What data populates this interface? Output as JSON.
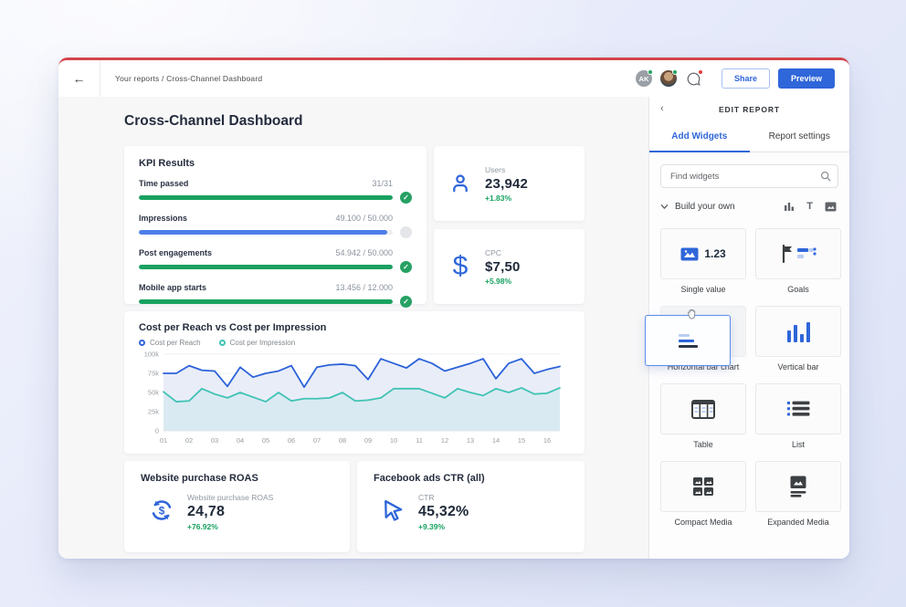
{
  "colors": {
    "accent_red": "#d4444c",
    "primary_blue": "#2f66d9",
    "green": "#17a261",
    "teal": "#3fc3b4"
  },
  "topbar": {
    "breadcrumb": "Your reports / Cross-Channel Dashboard",
    "avatar_initials": "AK",
    "share_label": "Share",
    "preview_label": "Preview"
  },
  "page": {
    "title": "Cross-Channel Dashboard"
  },
  "kpi": {
    "title": "KPI Results",
    "rows": [
      {
        "label": "Time passed",
        "value": "31/31",
        "pct": 100,
        "color": "green",
        "done": true
      },
      {
        "label": "Impressions",
        "value": "49.100 / 50.000",
        "pct": 98,
        "color": "blue",
        "done": false
      },
      {
        "label": "Post engagements",
        "value": "54.942 / 50.000",
        "pct": 100,
        "color": "green",
        "done": true
      },
      {
        "label": "Mobile app starts",
        "value": "13.456 / 12.000",
        "pct": 100,
        "color": "green",
        "done": true
      }
    ]
  },
  "stats": [
    {
      "label": "Users",
      "value": "23,942",
      "change": "+1.83%",
      "icon": "user-icon"
    },
    {
      "label": "CPC",
      "value": "$7,50",
      "change": "+5.98%",
      "icon": "dollar-icon"
    }
  ],
  "chart_data": {
    "type": "line",
    "title": "Cost per Reach vs Cost per Impression",
    "unit": "thousands",
    "ylim": [
      0,
      100
    ],
    "y_ticks": [
      "0",
      "25k",
      "50k",
      "75k",
      "100k"
    ],
    "x_labels": [
      "01",
      "02",
      "03",
      "04",
      "05",
      "06",
      "07",
      "08",
      "09",
      "10",
      "11",
      "12",
      "13",
      "14",
      "15",
      "16"
    ],
    "grid": true,
    "legend_position": "top",
    "series": [
      {
        "name": "Cost per Reach",
        "color": "#2c62d9",
        "fill": "#e9edf8",
        "values": [
          75,
          75,
          85,
          79,
          78,
          58,
          83,
          70,
          75,
          78,
          85,
          57,
          83,
          86,
          87,
          85,
          67,
          94,
          88,
          82,
          94,
          88,
          78,
          83,
          88,
          94,
          68,
          88,
          94,
          75,
          80,
          84
        ]
      },
      {
        "name": "Cost per Impression",
        "color": "#3fc3b4",
        "fill": "#daeaf2",
        "values": [
          51,
          38,
          39,
          55,
          48,
          43,
          50,
          44,
          38,
          50,
          39,
          42,
          42,
          43,
          50,
          39,
          40,
          43,
          55,
          55,
          55,
          49,
          43,
          55,
          50,
          46,
          55,
          50,
          56,
          48,
          49,
          56
        ]
      }
    ]
  },
  "bottom_cards": [
    {
      "title": "Website purchase ROAS",
      "label": "Website purchase ROAS",
      "value": "24,78",
      "change": "+76.92%",
      "icon": "roas-cycle-icon"
    },
    {
      "title": "Facebook ads CTR (all)",
      "label": "CTR",
      "value": "45,32%",
      "change": "+9.39%",
      "icon": "cursor-icon"
    }
  ],
  "sidebar": {
    "header": "EDIT REPORT",
    "tabs": [
      {
        "label": "Add Widgets",
        "active": true
      },
      {
        "label": "Report settings",
        "active": false
      }
    ],
    "search_placeholder": "Find widgets",
    "section": {
      "label": "Build your own",
      "tools": [
        "bar-chart-icon",
        "text-icon",
        "image-icon"
      ]
    },
    "widgets": [
      {
        "label": "Single value",
        "icon": "single-value-icon",
        "sample": "1.23"
      },
      {
        "label": "Goals",
        "icon": "goals-icon"
      },
      {
        "label": "Horizontal bar chart",
        "icon": "horizontal-bar-icon",
        "state": "dragging"
      },
      {
        "label": "Vertical bar",
        "icon": "vertical-bar-icon"
      },
      {
        "label": "Table",
        "icon": "table-icon"
      },
      {
        "label": "List",
        "icon": "list-icon"
      },
      {
        "label": "Compact Media",
        "icon": "compact-media-icon"
      },
      {
        "label": "Expanded Media",
        "icon": "expanded-media-icon"
      }
    ]
  }
}
